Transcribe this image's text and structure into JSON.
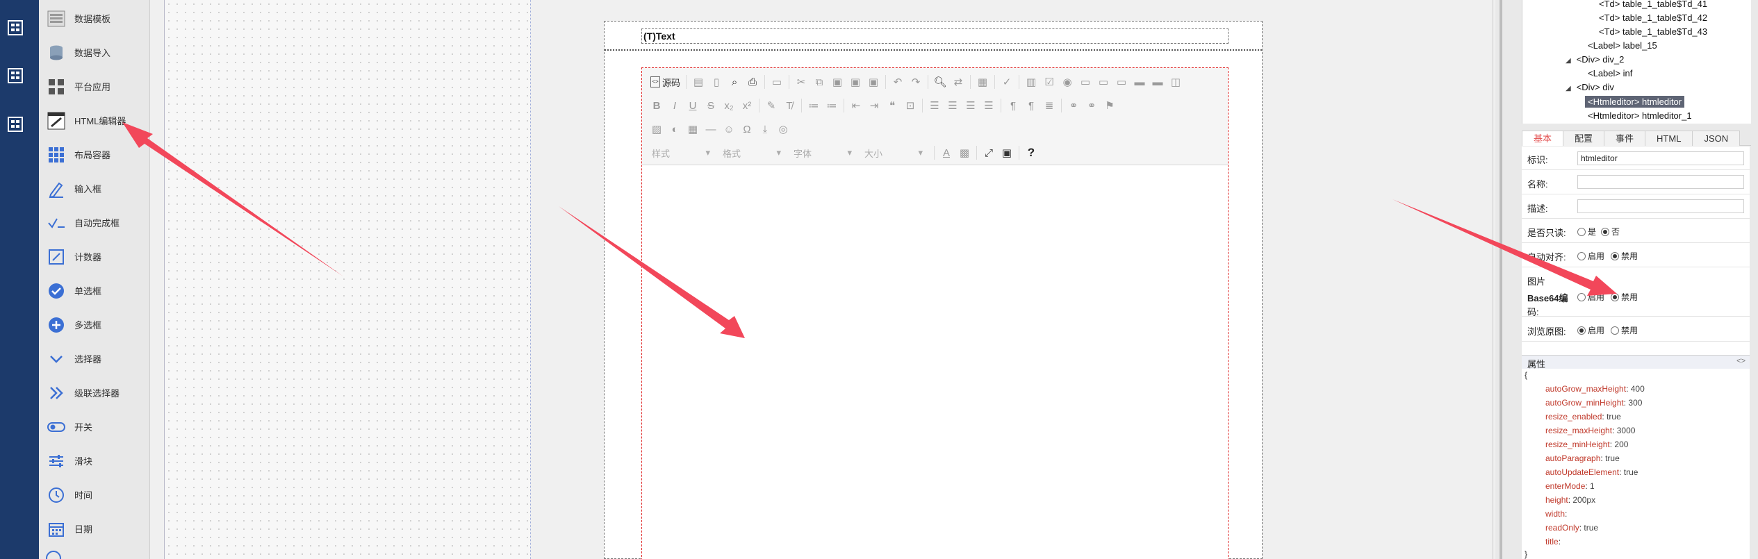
{
  "palette": {
    "items": [
      {
        "label": "数据模板",
        "icon": "data-template-icon"
      },
      {
        "label": "数据导入",
        "icon": "data-import-icon"
      },
      {
        "label": "平台应用",
        "icon": "platform-app-icon"
      },
      {
        "label": "HTML编辑器",
        "icon": "html-editor-icon"
      },
      {
        "label": "布局容器",
        "icon": "layout-container-icon"
      },
      {
        "label": "输入框",
        "icon": "input-icon"
      },
      {
        "label": "自动完成框",
        "icon": "autocomplete-icon"
      },
      {
        "label": "计数器",
        "icon": "counter-icon"
      },
      {
        "label": "单选框",
        "icon": "radio-icon"
      },
      {
        "label": "多选框",
        "icon": "checkbox-icon"
      },
      {
        "label": "选择器",
        "icon": "select-icon"
      },
      {
        "label": "级联选择器",
        "icon": "cascader-icon"
      },
      {
        "label": "开关",
        "icon": "switch-icon"
      },
      {
        "label": "滑块",
        "icon": "slider-icon"
      },
      {
        "label": "时间",
        "icon": "time-icon"
      },
      {
        "label": "日期",
        "icon": "date-icon"
      }
    ]
  },
  "form": {
    "text_label": "(T)Text",
    "editor": {
      "source_label": "源码",
      "combos": [
        "样式",
        "格式",
        "字体",
        "大小"
      ],
      "help": "?"
    }
  },
  "tree": {
    "nodes": [
      {
        "text": "<Td> table_1_table$Td_41",
        "indent": 3,
        "toggle": ""
      },
      {
        "text": "<Td> table_1_table$Td_42",
        "indent": 3,
        "toggle": ""
      },
      {
        "text": "<Td> table_1_table$Td_43",
        "indent": 3,
        "toggle": ""
      },
      {
        "text": "<Label> label_15",
        "indent": 2,
        "toggle": ""
      },
      {
        "text": "<Div> div_2",
        "indent": 1,
        "toggle": "◢"
      },
      {
        "text": "<Label> inf",
        "indent": 2,
        "toggle": ""
      },
      {
        "text": "<Div> div",
        "indent": 1,
        "toggle": "◢"
      },
      {
        "text": "<Htmleditor> htmleditor",
        "indent": 2,
        "toggle": "",
        "selected": true
      },
      {
        "text": "<Htmleditor> htmleditor_1",
        "indent": 2,
        "toggle": ""
      }
    ]
  },
  "tabs": [
    "基本",
    "配置",
    "事件",
    "HTML",
    "JSON"
  ],
  "props": {
    "id_label": "标识:",
    "id_value": "htmleditor",
    "name_label": "名称:",
    "desc_label": "描述:",
    "readonly_label": "是否只读:",
    "readonly_yes": "是",
    "readonly_no": "否",
    "align_label": "自动对齐:",
    "enable": "启用",
    "disable": "禁用",
    "image_label": "图片",
    "base64_label_1": "Base64编",
    "base64_label_2": "码:",
    "preview_label": "浏览原图:"
  },
  "attributes": {
    "title": "属性",
    "toggle": "<>",
    "open": "{",
    "close": "}",
    "entries": [
      {
        "key": "autoGrow_maxHeight",
        "value": "400"
      },
      {
        "key": "autoGrow_minHeight",
        "value": "300"
      },
      {
        "key": "resize_enabled",
        "value": "true"
      },
      {
        "key": "resize_maxHeight",
        "value": "3000"
      },
      {
        "key": "resize_minHeight",
        "value": "200"
      },
      {
        "key": "autoParagraph",
        "value": "true"
      },
      {
        "key": "autoUpdateElement",
        "value": "true"
      },
      {
        "key": "enterMode",
        "value": "1"
      },
      {
        "key": "height",
        "value": "200px"
      },
      {
        "key": "width",
        "value": ""
      },
      {
        "key": "readOnly",
        "value": "true"
      },
      {
        "key": "title",
        "value": ""
      }
    ]
  },
  "colors": {
    "rail": "#1c3a6b",
    "accent_red": "#f2475a",
    "selected_node": "#5e6474",
    "json_key": "#c0392b"
  }
}
